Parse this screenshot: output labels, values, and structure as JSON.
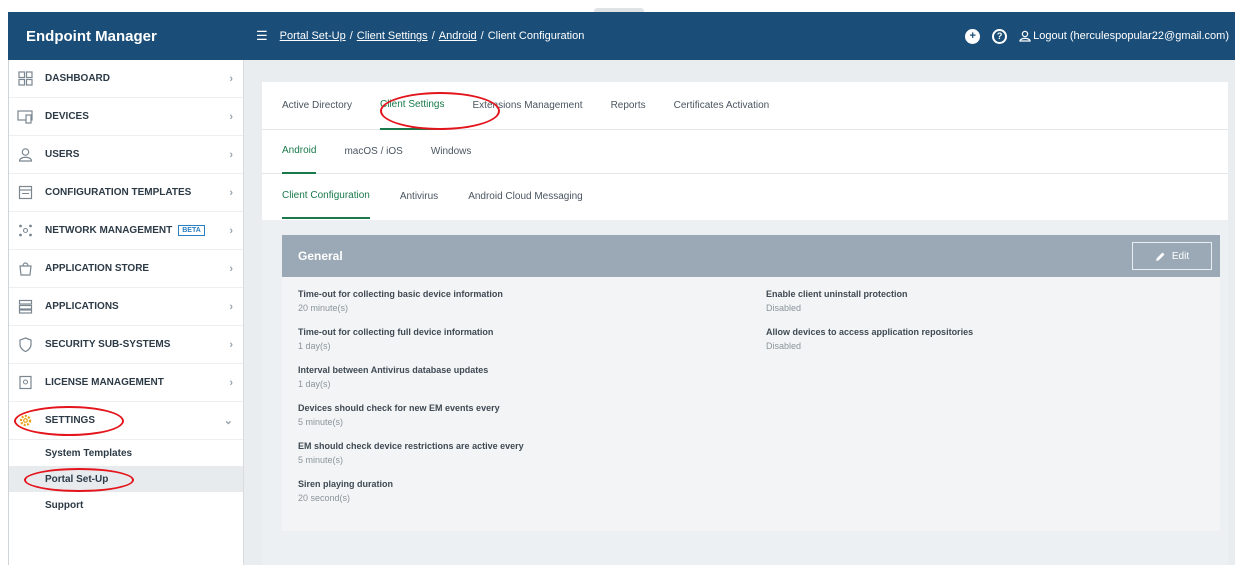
{
  "app": {
    "title": "Endpoint Manager"
  },
  "header": {
    "breadcrumb": [
      "Portal Set-Up",
      "Client Settings",
      "Android",
      "Client Configuration"
    ],
    "logout": "Logout (herculespopular22@gmail.com)"
  },
  "sidebar": {
    "items": [
      {
        "label": "DASHBOARD",
        "icon": "dashboard-icon"
      },
      {
        "label": "DEVICES",
        "icon": "devices-icon"
      },
      {
        "label": "USERS",
        "icon": "users-icon"
      },
      {
        "label": "CONFIGURATION TEMPLATES",
        "icon": "templates-icon"
      },
      {
        "label": "NETWORK MANAGEMENT",
        "icon": "network-icon",
        "badge": "BETA"
      },
      {
        "label": "APPLICATION STORE",
        "icon": "store-icon"
      },
      {
        "label": "APPLICATIONS",
        "icon": "applications-icon"
      },
      {
        "label": "SECURITY SUB-SYSTEMS",
        "icon": "shield-icon"
      },
      {
        "label": "LICENSE MANAGEMENT",
        "icon": "license-icon"
      },
      {
        "label": "SETTINGS",
        "icon": "gear-icon"
      }
    ],
    "subitems": [
      "System Templates",
      "Portal Set-Up",
      "Support"
    ]
  },
  "tabs": [
    "Active Directory",
    "Client Settings",
    "Extensions Management",
    "Reports",
    "Certificates Activation"
  ],
  "os_tabs": [
    "Android",
    "macOS / iOS",
    "Windows"
  ],
  "config_tabs": [
    "Client Configuration",
    "Antivirus",
    "Android Cloud Messaging"
  ],
  "general": {
    "title": "General",
    "edit_label": "Edit",
    "left_fields": [
      {
        "label": "Time-out for collecting basic device information",
        "value": "20 minute(s)"
      },
      {
        "label": "Time-out for collecting full device information",
        "value": "1 day(s)"
      },
      {
        "label": "Interval between Antivirus database updates",
        "value": "1 day(s)"
      },
      {
        "label": "Devices should check for new EM events every",
        "value": "5 minute(s)"
      },
      {
        "label": "EM should check device restrictions are active every",
        "value": "5 minute(s)"
      },
      {
        "label": "Siren playing duration",
        "value": "20 second(s)"
      }
    ],
    "right_fields": [
      {
        "label": "Enable client uninstall protection",
        "value": "Disabled"
      },
      {
        "label": "Allow devices to access application repositories",
        "value": "Disabled"
      }
    ]
  },
  "colors": {
    "header": "#1a4e78",
    "accent": "#19794a",
    "annotation": "#e3141b",
    "card_header": "#9aa9b5"
  }
}
